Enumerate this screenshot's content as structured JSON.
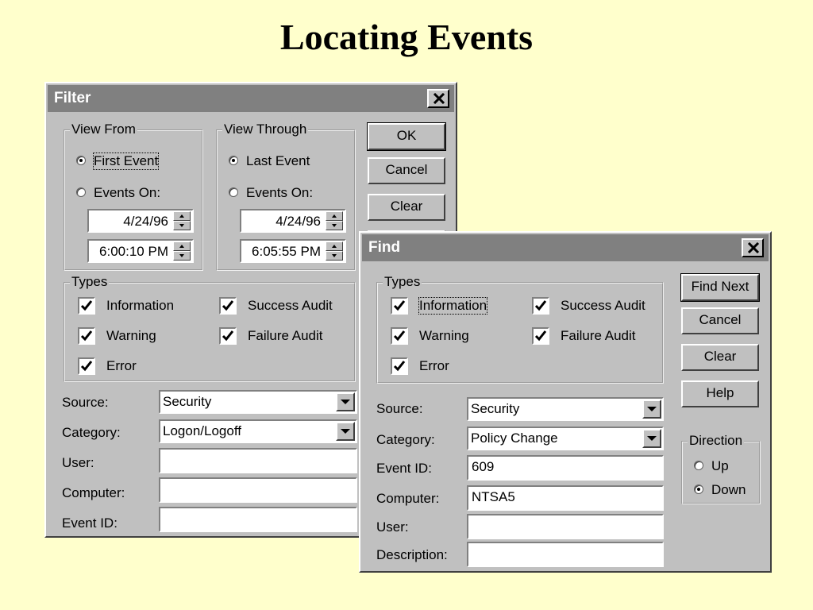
{
  "slide": {
    "title": "Locating Events"
  },
  "filter": {
    "title": "Filter",
    "view_from": {
      "label": "View From",
      "first_event": "First Event",
      "events_on": "Events On:",
      "date": "4/24/96",
      "time": "6:00:10 PM",
      "selected": "first_event"
    },
    "view_through": {
      "label": "View Through",
      "last_event": "Last Event",
      "events_on": "Events On:",
      "date": "4/24/96",
      "time": "6:05:55 PM",
      "selected": "last_event"
    },
    "buttons": {
      "ok": "OK",
      "cancel": "Cancel",
      "clear": "Clear"
    },
    "types": {
      "label": "Types",
      "information": "Information",
      "success_audit": "Success Audit",
      "warning": "Warning",
      "failure_audit": "Failure Audit",
      "error": "Error"
    },
    "fields": {
      "source_label": "Source:",
      "source_value": "Security",
      "category_label": "Category:",
      "category_value": "Logon/Logoff",
      "user_label": "User:",
      "user_value": "",
      "computer_label": "Computer:",
      "computer_value": "",
      "event_id_label": "Event ID:",
      "event_id_value": ""
    }
  },
  "find": {
    "title": "Find",
    "types": {
      "label": "Types",
      "information": "Information",
      "success_audit": "Success Audit",
      "warning": "Warning",
      "failure_audit": "Failure Audit",
      "error": "Error"
    },
    "buttons": {
      "find_next": "Find Next",
      "cancel": "Cancel",
      "clear": "Clear",
      "help": "Help"
    },
    "direction": {
      "label": "Direction",
      "up": "Up",
      "down": "Down",
      "selected": "down"
    },
    "fields": {
      "source_label": "Source:",
      "source_value": "Security",
      "category_label": "Category:",
      "category_value": "Policy Change",
      "event_id_label": "Event ID:",
      "event_id_value": "609",
      "computer_label": "Computer:",
      "computer_value": "NTSA5",
      "user_label": "User:",
      "user_value": "",
      "description_label": "Description:",
      "description_value": ""
    }
  }
}
